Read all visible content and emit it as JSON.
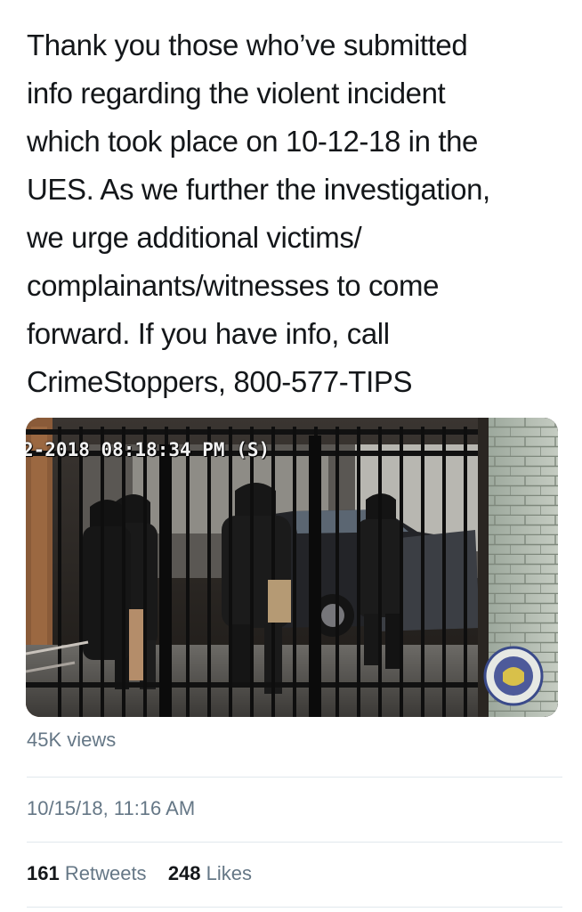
{
  "tweet": {
    "text_lines": [
      "Thank you those who’ve submitted",
      "info regarding the violent incident",
      "which took place on 10-12-18 in the",
      "UES. As we further the investigation,",
      "we urge additional victims/",
      "complainants/witnesses to come",
      "forward. If you have info, call",
      "CrimeStoppers, 800-577-TIPS"
    ]
  },
  "media": {
    "overlay_timestamp": "2-2018 08:18:34 PM (S)",
    "badge_icon": "police-seal-icon"
  },
  "stats": {
    "views": "45K views",
    "date": "10/15/18, 11:16 AM",
    "retweets_count": "161",
    "retweets_label": "Retweets",
    "likes_count": "248",
    "likes_label": "Likes"
  },
  "colors": {
    "text_primary": "#14171a",
    "text_secondary": "#657786",
    "divider": "#e1e8ed"
  }
}
